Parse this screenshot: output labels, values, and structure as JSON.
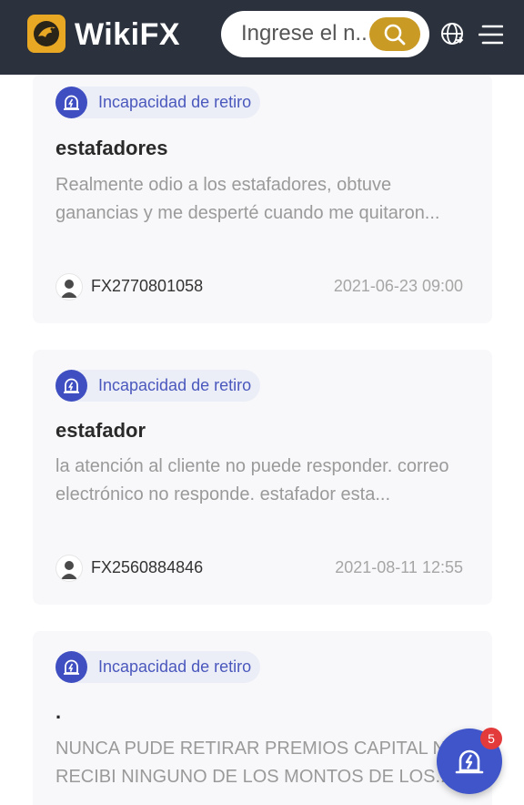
{
  "header": {
    "logo_text": "WikiFX",
    "search_placeholder": "Ingrese el n...",
    "search_icon": "search-icon",
    "globe_icon": "globe-icon",
    "menu_icon": "menu-icon"
  },
  "reviews": [
    {
      "tag": "Incapacidad de retiro",
      "title": "estafadores",
      "excerpt_line1": "Realmente odio a los estafadores, obtuve",
      "excerpt_line2": "ganancias y me desperté cuando me quitaron...",
      "author": "FX2770801058",
      "date": "2021-06-23 09:00"
    },
    {
      "tag": "Incapacidad de retiro",
      "title": "estafador",
      "excerpt_line1": "la atención al cliente no puede responder. correo",
      "excerpt_line2": "electrónico no responde. estafador esta...",
      "author": "FX2560884846",
      "date": "2021-08-11 12:55"
    },
    {
      "tag": "Incapacidad de retiro",
      "title": ".",
      "excerpt_line1": "NUNCA PUDE RETIRAR PREMIOS CAPITAL NI",
      "excerpt_line2": "RECIBI NINGUNO DE LOS MONTOS DE LOS..."
    }
  ],
  "fab": {
    "badge_count": "5",
    "icon": "alarm-icon"
  },
  "colors": {
    "header_bg": "#2b323d",
    "accent_gold": "#c99a24",
    "tag_blue": "#4a58bd",
    "fab_blue": "#3f55c9",
    "badge_red": "#e33b3b"
  }
}
